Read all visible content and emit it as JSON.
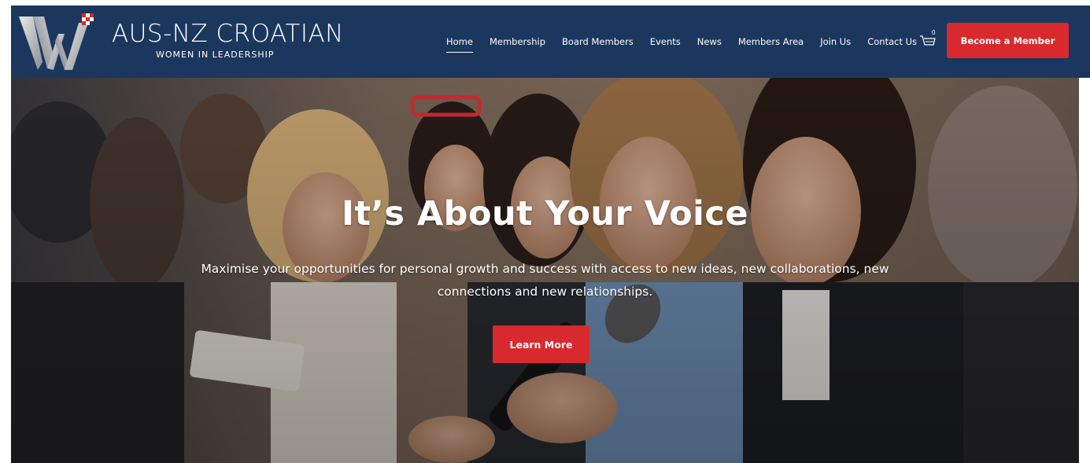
{
  "brand": {
    "title": "AUS-NZ CROATIAN",
    "subtitle": "WOMEN IN LEADERSHIP",
    "logo_icon": "w-logo-icon"
  },
  "nav": {
    "items": [
      {
        "label": "Home",
        "active": true
      },
      {
        "label": "Membership",
        "active": false
      },
      {
        "label": "Board Members",
        "active": false
      },
      {
        "label": "Events",
        "active": false
      },
      {
        "label": "News",
        "active": false
      },
      {
        "label": "Members Area",
        "active": false
      },
      {
        "label": "Join Us",
        "active": false
      },
      {
        "label": "Contact Us",
        "active": false
      }
    ],
    "cart_icon": "cart-icon",
    "cart_count": "0",
    "cta_label": "Become a Member"
  },
  "hero": {
    "title": "It’s About Your Voice",
    "text": "Maximise your opportunities for personal growth and success with access to new ideas, new collaborations, new connections and new relationships.",
    "button_label": "Learn More"
  },
  "colors": {
    "header_bg": "#1c375e",
    "accent_red": "#d82a2e",
    "text_white": "#ffffff"
  }
}
